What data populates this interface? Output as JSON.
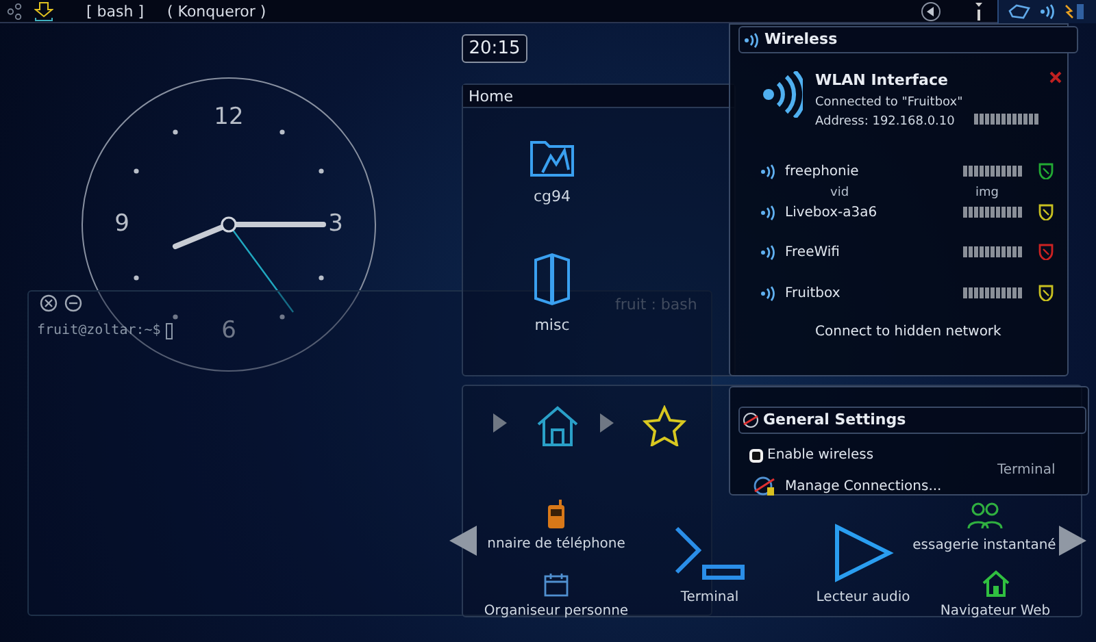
{
  "panel": {
    "taskbar": [
      {
        "label": "[ bash ]"
      },
      {
        "label": "( Konqueror )"
      }
    ]
  },
  "digital_clock": {
    "time": "20:15"
  },
  "analog_clock": {
    "numerals": [
      "12",
      "3",
      "6",
      "9"
    ]
  },
  "terminal": {
    "title": "fruit : bash",
    "prompt": "fruit@zoltar:~$"
  },
  "folder_view": {
    "title": "Home",
    "items": [
      {
        "label": "cg94",
        "kind": "folder"
      },
      {
        "label": "misc",
        "kind": "box"
      },
      {
        "label": "vid",
        "kind": "label"
      },
      {
        "label": "img",
        "kind": "label"
      }
    ]
  },
  "launcher": {
    "items": [
      {
        "label": "nnaire de téléphone",
        "kind": "phone"
      },
      {
        "label": "Organiseur personne",
        "kind": "calendar"
      },
      {
        "label": "Terminal",
        "kind": "terminal"
      },
      {
        "label": "Lecteur audio",
        "kind": "play"
      },
      {
        "label": "essagerie instantané",
        "kind": "people"
      },
      {
        "label": "Navigateur Web",
        "kind": "web"
      }
    ]
  },
  "wireless": {
    "title": "Wireless",
    "interface": {
      "name": "WLAN Interface",
      "status": "Connected to \"Fruitbox\"",
      "address": "Address: 192.168.0.10"
    },
    "networks": [
      {
        "name": "freephonie",
        "color": "#22aa33"
      },
      {
        "name": "Livebox-a3a6",
        "color": "#c8c020"
      },
      {
        "name": "FreeWifi",
        "color": "#cc2222"
      },
      {
        "name": "Fruitbox",
        "color": "#c8c020"
      }
    ],
    "hidden_link": "Connect to hidden network"
  },
  "general_settings": {
    "title": "General Settings",
    "enable_wireless": {
      "label": "Enable wireless",
      "checked": false
    },
    "manage": "Manage Connections...",
    "behind_label": "Terminal"
  }
}
